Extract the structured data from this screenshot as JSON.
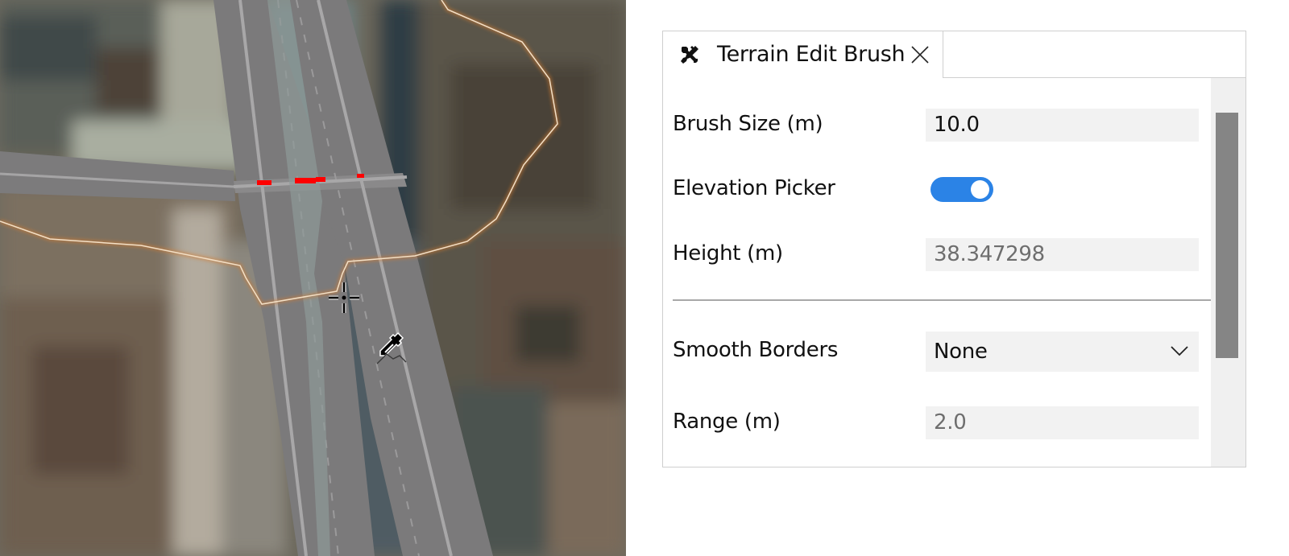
{
  "map": {
    "description": "3D terrain / road network view over satellite imagery",
    "cursor": "crosshair",
    "tool_cursor": "eyedropper-elevation-icon",
    "highlight_color": "#ff0000",
    "boundary_color": "#e7a15a"
  },
  "panel": {
    "tab": {
      "icon": "tools-icon",
      "title": "Terrain Edit Brush",
      "close_icon": "close-icon"
    },
    "window_controls": {
      "minimize": "minimize-icon",
      "maximize": "maximize-icon"
    },
    "fields": {
      "brush_size": {
        "label": "Brush Size (m)",
        "value": "10.0"
      },
      "elevation_picker": {
        "label": "Elevation Picker",
        "value": true
      },
      "height": {
        "label": "Height (m)",
        "value": "38.347298"
      },
      "smooth_borders": {
        "label": "Smooth Borders",
        "value": "None"
      },
      "range": {
        "label": "Range (m)",
        "value": "2.0"
      }
    },
    "accent_color": "#2b83e6"
  }
}
